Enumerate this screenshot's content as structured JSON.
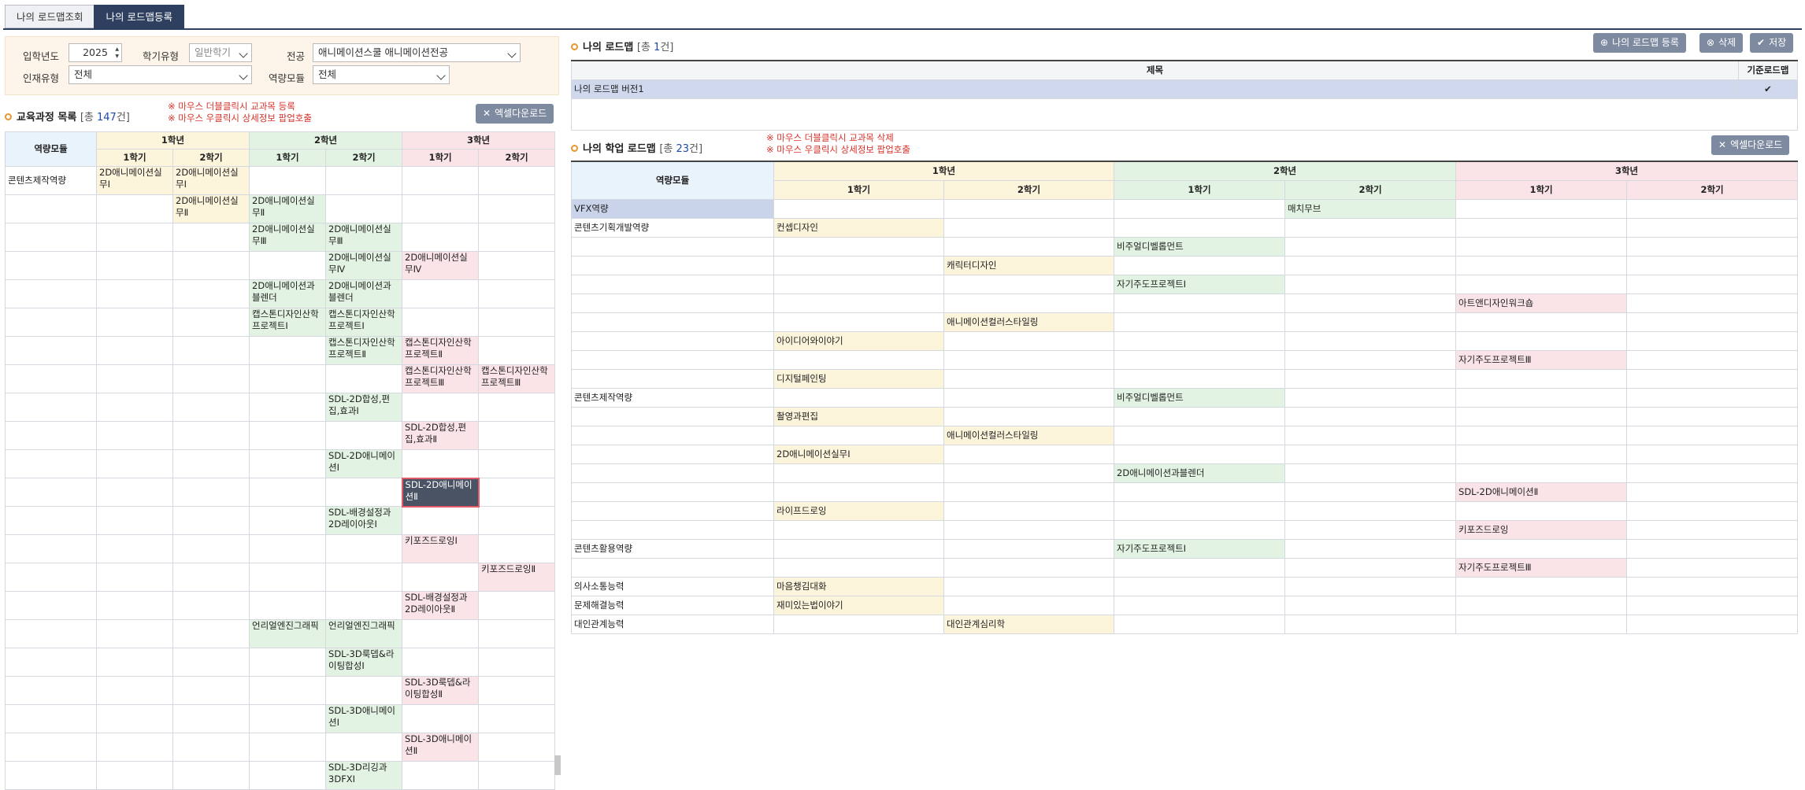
{
  "tabs": [
    {
      "label": "나의 로드맵조회"
    },
    {
      "label": "나의 로드맵등록"
    }
  ],
  "filters": {
    "year_label": "입학년도",
    "year_value": "2025",
    "semester_type_label": "학기유형",
    "semester_type_value": "일반학기",
    "major_label": "전공",
    "major_value": "애니메이션스쿨 애니메이션전공",
    "talent_label": "인재유형",
    "talent_value": "전체",
    "competency_label": "역량모듈",
    "competency_value": "전체"
  },
  "course_list": {
    "title": "교육과정 목록",
    "count_prefix": "[총 ",
    "count": "147",
    "count_suffix": "건]",
    "hint1": "※ 마우스 더블클릭시 교과목 등록",
    "hint2": "※ 마우스 우클릭시 상세정보 팝업호출",
    "excel_button": "엑셀다운로드",
    "col_module": "역량모듈",
    "years": [
      "1학년",
      "2학년",
      "3학년"
    ],
    "semesters": [
      "1학기",
      "2학기",
      "1학기",
      "2학기",
      "1학기",
      "2학기"
    ],
    "first_module": "콘텐츠제작역량",
    "rows": [
      [
        "2D애니메이션실무Ⅰ",
        "2D애니메이션실무Ⅰ",
        "",
        "",
        "",
        ""
      ],
      [
        "",
        "2D애니메이션실무Ⅱ",
        "2D애니메이션실무Ⅱ",
        "",
        "",
        ""
      ],
      [
        "",
        "",
        "2D애니메이션실무Ⅲ",
        "2D애니메이션실무Ⅲ",
        "",
        ""
      ],
      [
        "",
        "",
        "",
        "2D애니메이션실무Ⅳ",
        "2D애니메이션실무Ⅳ",
        ""
      ],
      [
        "",
        "",
        "2D애니메이션과블렌더",
        "2D애니메이션과블렌더",
        "",
        ""
      ],
      [
        "",
        "",
        "캡스톤디자인산학프로젝트Ⅰ",
        "캡스톤디자인산학프로젝트Ⅰ",
        "",
        ""
      ],
      [
        "",
        "",
        "",
        "캡스톤디자인산학프로젝트Ⅱ",
        "캡스톤디자인산학프로젝트Ⅱ",
        ""
      ],
      [
        "",
        "",
        "",
        "",
        "캡스톤디자인산학프로젝트Ⅲ",
        "캡스톤디자인산학프로젝트Ⅲ"
      ],
      [
        "",
        "",
        "",
        "SDL-2D합성,편집,효과Ⅰ",
        "",
        ""
      ],
      [
        "",
        "",
        "",
        "",
        "SDL-2D합성,편집,효과Ⅱ",
        ""
      ],
      [
        "",
        "",
        "",
        "SDL-2D애니메이션Ⅰ",
        "",
        ""
      ],
      [
        "",
        "",
        "",
        "",
        "SDL-2D애니메이션Ⅱ",
        ""
      ],
      [
        "",
        "",
        "",
        "SDL-배경설정과2D레이아웃Ⅰ",
        "",
        ""
      ],
      [
        "",
        "",
        "",
        "",
        "키포즈드로잉Ⅰ",
        ""
      ],
      [
        "",
        "",
        "",
        "",
        "",
        "키포즈드로잉Ⅱ"
      ],
      [
        "",
        "",
        "",
        "",
        "SDL-배경설정과2D레이아웃Ⅱ",
        ""
      ],
      [
        "",
        "",
        "언리얼엔진그래픽",
        "언리얼엔진그래픽",
        "",
        ""
      ],
      [
        "",
        "",
        "",
        "SDL-3D룩뎁&라이팅합성Ⅰ",
        "",
        ""
      ],
      [
        "",
        "",
        "",
        "",
        "SDL-3D룩뎁&라이팅합성Ⅱ",
        ""
      ],
      [
        "",
        "",
        "",
        "SDL-3D애니메이션Ⅰ",
        "",
        ""
      ],
      [
        "",
        "",
        "",
        "",
        "SDL-3D애니메이션Ⅱ",
        ""
      ],
      [
        "",
        "",
        "",
        "SDL-3D리깅과3DFXⅠ",
        "",
        ""
      ]
    ]
  },
  "my_roadmap": {
    "title": "나의 로드맵",
    "count_prefix": "[총 ",
    "count": "1",
    "count_suffix": "건]",
    "register_button": "나의 로드맵 등록",
    "delete_button": "삭제",
    "save_button": "저장",
    "col_title": "제목",
    "col_default": "기준로드맵",
    "rows": [
      {
        "title": "나의 로드맵 버전1",
        "default_mark": "✔"
      }
    ]
  },
  "academic_roadmap": {
    "title": "나의 학업 로드맵",
    "count_prefix": "[총 ",
    "count": "23",
    "count_suffix": "건]",
    "hint1": "※ 마우스 더블클릭시 교과목 삭제",
    "hint2": "※ 마우스 우클릭시 상세정보 팝업호출",
    "excel_button": "엑셀다운로드",
    "col_module": "역량모듈",
    "years": [
      "1학년",
      "2학년",
      "3학년"
    ],
    "semesters": [
      "1학기",
      "2학기",
      "1학기",
      "2학기",
      "1학기",
      "2학기"
    ],
    "rows": [
      {
        "module": "VFX역량",
        "cells": [
          "",
          "",
          "",
          "매치무브",
          "",
          ""
        ]
      },
      {
        "module": "콘텐츠기획개발역량",
        "cells": [
          "컨셉디자인",
          "",
          "",
          "",
          "",
          ""
        ]
      },
      {
        "module": "",
        "cells": [
          "",
          "",
          "비주얼디벨롭먼트",
          "",
          "",
          ""
        ]
      },
      {
        "module": "",
        "cells": [
          "",
          "캐릭터디자인",
          "",
          "",
          "",
          ""
        ]
      },
      {
        "module": "",
        "cells": [
          "",
          "",
          "자기주도프로젝트Ⅰ",
          "",
          "",
          ""
        ]
      },
      {
        "module": "",
        "cells": [
          "",
          "",
          "",
          "",
          "아트앤디자인워크숍",
          ""
        ]
      },
      {
        "module": "",
        "cells": [
          "",
          "애니메이션컬러스타일링",
          "",
          "",
          "",
          ""
        ]
      },
      {
        "module": "",
        "cells": [
          "아이디어와이야기",
          "",
          "",
          "",
          "",
          ""
        ]
      },
      {
        "module": "",
        "cells": [
          "",
          "",
          "",
          "",
          "자기주도프로젝트Ⅲ",
          ""
        ]
      },
      {
        "module": "",
        "cells": [
          "디지털페인팅",
          "",
          "",
          "",
          "",
          ""
        ]
      },
      {
        "module": "콘텐츠제작역량",
        "cells": [
          "",
          "",
          "비주얼디벨롭먼트",
          "",
          "",
          ""
        ]
      },
      {
        "module": "",
        "cells": [
          "촬영과편집",
          "",
          "",
          "",
          "",
          ""
        ]
      },
      {
        "module": "",
        "cells": [
          "",
          "애니메이션컬러스타일링",
          "",
          "",
          "",
          ""
        ]
      },
      {
        "module": "",
        "cells": [
          "2D애니메이션실무Ⅰ",
          "",
          "",
          "",
          "",
          ""
        ]
      },
      {
        "module": "",
        "cells": [
          "",
          "",
          "2D애니메이션과블렌더",
          "",
          "",
          ""
        ]
      },
      {
        "module": "",
        "cells": [
          "",
          "",
          "",
          "",
          "SDL-2D애니메이션Ⅱ",
          ""
        ]
      },
      {
        "module": "",
        "cells": [
          "라이프드로잉",
          "",
          "",
          "",
          "",
          ""
        ]
      },
      {
        "module": "",
        "cells": [
          "",
          "",
          "",
          "",
          "키포즈드로잉",
          ""
        ]
      },
      {
        "module": "콘텐츠활용역량",
        "cells": [
          "",
          "",
          "자기주도프로젝트Ⅰ",
          "",
          "",
          ""
        ]
      },
      {
        "module": "",
        "cells": [
          "",
          "",
          "",
          "",
          "자기주도프로젝트Ⅲ",
          ""
        ]
      },
      {
        "module": "의사소통능력",
        "cells": [
          "마음챙김대화",
          "",
          "",
          "",
          "",
          ""
        ]
      },
      {
        "module": "문제해결능력",
        "cells": [
          "재미있는법이야기",
          "",
          "",
          "",
          "",
          ""
        ]
      },
      {
        "module": "대인관계능력",
        "cells": [
          "",
          "대인관계심리학",
          "",
          "",
          "",
          ""
        ]
      }
    ]
  }
}
